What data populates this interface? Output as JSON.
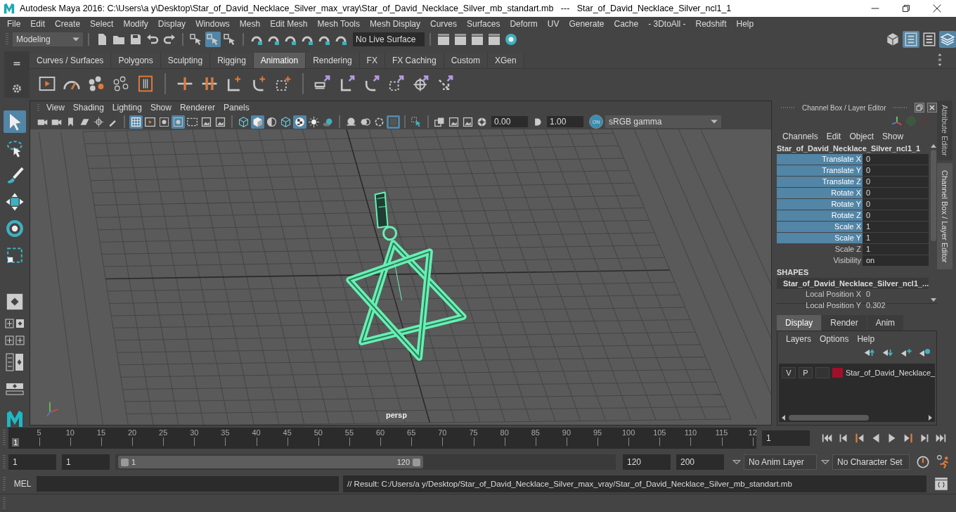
{
  "window": {
    "title": "Autodesk Maya 2016: C:\\Users\\a y\\Desktop\\Star_of_David_Necklace_Silver_max_vray\\Star_of_David_Necklace_Silver_mb_standart.mb   ---   Star_of_David_Necklace_Silver_ncl1_1"
  },
  "menu": [
    "File",
    "Edit",
    "Create",
    "Select",
    "Modify",
    "Display",
    "Windows",
    "Mesh",
    "Edit Mesh",
    "Mesh Tools",
    "Mesh Display",
    "Curves",
    "Surfaces",
    "Deform",
    "UV",
    "Generate",
    "Cache",
    "- 3DtoAll -",
    "Redshift",
    "Help"
  ],
  "status_line": {
    "mode": "Modeling",
    "live_surface": "No Live Surface",
    "buttons": [
      {
        "kind": "new-file",
        "on": false
      },
      {
        "kind": "open-folder",
        "on": false
      },
      {
        "kind": "save",
        "on": false
      },
      {
        "kind": "undo",
        "on": false
      },
      {
        "kind": "redo",
        "on": false
      },
      {
        "kind": "sep"
      },
      {
        "kind": "cursor",
        "on": false
      },
      {
        "kind": "cursor",
        "on": true
      },
      {
        "kind": "cursor",
        "on": false
      },
      {
        "kind": "sep"
      },
      {
        "kind": "magnet",
        "on": false
      },
      {
        "kind": "magnet",
        "on": false
      },
      {
        "kind": "magnet",
        "on": false
      },
      {
        "kind": "magnet",
        "on": false
      },
      {
        "kind": "magnet",
        "on": false
      },
      {
        "kind": "magnet",
        "on": false
      }
    ],
    "render_buttons": [
      {
        "kind": "clapboard",
        "on": false
      },
      {
        "kind": "clapboard",
        "on": false
      },
      {
        "kind": "clapboard",
        "on": false
      },
      {
        "kind": "clapboard",
        "on": false
      },
      {
        "kind": "hypershade",
        "on": false
      }
    ],
    "panel_buttons": [
      {
        "kind": "cube",
        "on": false
      },
      {
        "kind": "panel-list",
        "on": true
      },
      {
        "kind": "panel-list",
        "on": false
      },
      {
        "kind": "layers",
        "on": true
      }
    ]
  },
  "shelf": {
    "tabs": [
      {
        "label": "Curves / Surfaces",
        "selected": false
      },
      {
        "label": "Polygons",
        "selected": false
      },
      {
        "label": "Sculpting",
        "selected": false
      },
      {
        "label": "Rigging",
        "selected": false
      },
      {
        "label": "Animation",
        "selected": true
      },
      {
        "label": "Rendering",
        "selected": false
      },
      {
        "label": "FX",
        "selected": false
      },
      {
        "label": "FX Caching",
        "selected": false
      },
      {
        "label": "Custom",
        "selected": false
      },
      {
        "label": "XGen",
        "selected": false
      }
    ],
    "buttons": [
      {
        "kind": "film"
      },
      {
        "kind": "gauge"
      },
      {
        "kind": "dots"
      },
      {
        "kind": "dots-outline"
      },
      {
        "kind": "key-box"
      },
      {
        "kind": "sep"
      },
      {
        "kind": "key-line"
      },
      {
        "kind": "key-double"
      },
      {
        "kind": "key-move"
      },
      {
        "kind": "key-rotate"
      },
      {
        "kind": "key-scale"
      },
      {
        "kind": "sep"
      },
      {
        "kind": "link-box"
      },
      {
        "kind": "link-move"
      },
      {
        "kind": "link-rotate"
      },
      {
        "kind": "link-scale"
      },
      {
        "kind": "link-target"
      },
      {
        "kind": "link-arrow"
      }
    ]
  },
  "toolbox": [
    {
      "kind": "select",
      "selected": true
    },
    {
      "kind": "lasso",
      "selected": false
    },
    {
      "kind": "paint",
      "selected": false
    },
    {
      "kind": "move",
      "selected": false
    },
    {
      "kind": "rotate",
      "selected": false
    },
    {
      "kind": "scale",
      "selected": false
    }
  ],
  "viewport": {
    "menu": [
      "View",
      "Shading",
      "Lighting",
      "Show",
      "Renderer",
      "Panels"
    ],
    "buttons": [
      {
        "kind": "camera",
        "on": false
      },
      {
        "kind": "camera",
        "on": false
      },
      {
        "kind": "bookmark",
        "on": false
      },
      {
        "kind": "plane",
        "on": false
      },
      {
        "kind": "pivot",
        "on": false
      },
      {
        "kind": "brush",
        "on": false
      },
      {
        "kind": "sep"
      },
      {
        "kind": "grid",
        "on": true
      },
      {
        "kind": "film",
        "on": false
      },
      {
        "kind": "circle",
        "on": false
      },
      {
        "kind": "circle",
        "on": true
      },
      {
        "kind": "resolution",
        "on": false
      },
      {
        "kind": "image",
        "on": false
      },
      {
        "kind": "image",
        "on": false
      },
      {
        "kind": "sep"
      },
      {
        "kind": "cube-wire",
        "on": false
      },
      {
        "kind": "cube-solid",
        "on": true
      },
      {
        "kind": "half",
        "on": false
      },
      {
        "kind": "cube-wire",
        "on": false
      },
      {
        "kind": "checker",
        "on": true
      },
      {
        "kind": "light",
        "on": false
      },
      {
        "kind": "shadow",
        "on": false
      },
      {
        "kind": "sep"
      },
      {
        "kind": "sphere",
        "on": false
      },
      {
        "kind": "rings",
        "on": false
      },
      {
        "kind": "ring",
        "on": false
      },
      {
        "kind": "square",
        "on": true
      },
      {
        "kind": "sep"
      },
      {
        "kind": "cursor-select",
        "on": false
      },
      {
        "kind": "sep"
      },
      {
        "kind": "stack",
        "on": false
      },
      {
        "kind": "image",
        "on": false
      },
      {
        "kind": "image",
        "on": false
      },
      {
        "kind": "aperture",
        "on": false
      }
    ],
    "exposure": "0.00",
    "gamma": "1.00",
    "color_toggle": {
      "label": "ON",
      "on": true
    },
    "color_space": "sRGB gamma",
    "camera": "persp"
  },
  "channel_box": {
    "title": "Channel Box / Layer Editor",
    "menu": [
      "Channels",
      "Edit",
      "Object",
      "Show"
    ],
    "object": "Star_of_David_Necklace_Silver_ncl1_1",
    "channels": [
      {
        "label": "Translate X",
        "value": "0",
        "selected": true
      },
      {
        "label": "Translate Y",
        "value": "0",
        "selected": true
      },
      {
        "label": "Translate Z",
        "value": "0",
        "selected": true
      },
      {
        "label": "Rotate X",
        "value": "0",
        "selected": true
      },
      {
        "label": "Rotate Y",
        "value": "0",
        "selected": true
      },
      {
        "label": "Rotate Z",
        "value": "0",
        "selected": true
      },
      {
        "label": "Scale X",
        "value": "1",
        "selected": true
      },
      {
        "label": "Scale Y",
        "value": "1",
        "selected": true
      },
      {
        "label": "Scale Z",
        "value": "1",
        "selected": false
      },
      {
        "label": "Visibility",
        "value": "on",
        "selected": false
      }
    ],
    "shapes_heading": "SHAPES",
    "shape": "Star_of_David_Necklace_Silver_ncl1_...",
    "shape_channels": [
      {
        "label": "Local Position X",
        "value": "0"
      },
      {
        "label": "Local Position Y",
        "value": "0.302"
      }
    ]
  },
  "layer_editor": {
    "tabs": [
      {
        "label": "Display",
        "selected": true
      },
      {
        "label": "Render",
        "selected": false
      },
      {
        "label": "Anim",
        "selected": false
      }
    ],
    "menu": [
      "Layers",
      "Options",
      "Help"
    ],
    "layers": [
      {
        "visible": "V",
        "playback": "P",
        "name": "Star_of_David_Necklace_",
        "color": "#a0102a"
      }
    ]
  },
  "side_tabs": [
    {
      "label": "Attribute Editor",
      "selected": false
    },
    {
      "label": "Channel Box / Layer Editor",
      "selected": true
    }
  ],
  "timeline": {
    "ticks": [
      "5",
      "10",
      "15",
      "20",
      "25",
      "30",
      "35",
      "40",
      "45",
      "50",
      "55",
      "60",
      "65",
      "70",
      "75",
      "80",
      "85",
      "90",
      "95",
      "100",
      "105",
      "110",
      "115",
      "12"
    ],
    "start": "1",
    "level": 0,
    "current_frame": "1"
  },
  "range": {
    "start": "1",
    "playback_start": "1",
    "slider_start": "1",
    "slider_end": "120",
    "playback_end": "120",
    "end": "200",
    "anim_layer": "No Anim Layer",
    "character_set": "No Character Set"
  },
  "command_line": {
    "label": "MEL",
    "result": "// Result: C:/Users/a y/Desktop/Star_of_David_Necklace_Silver_max_vray/Star_of_David_Necklace_Silver_mb_standart.mb"
  }
}
